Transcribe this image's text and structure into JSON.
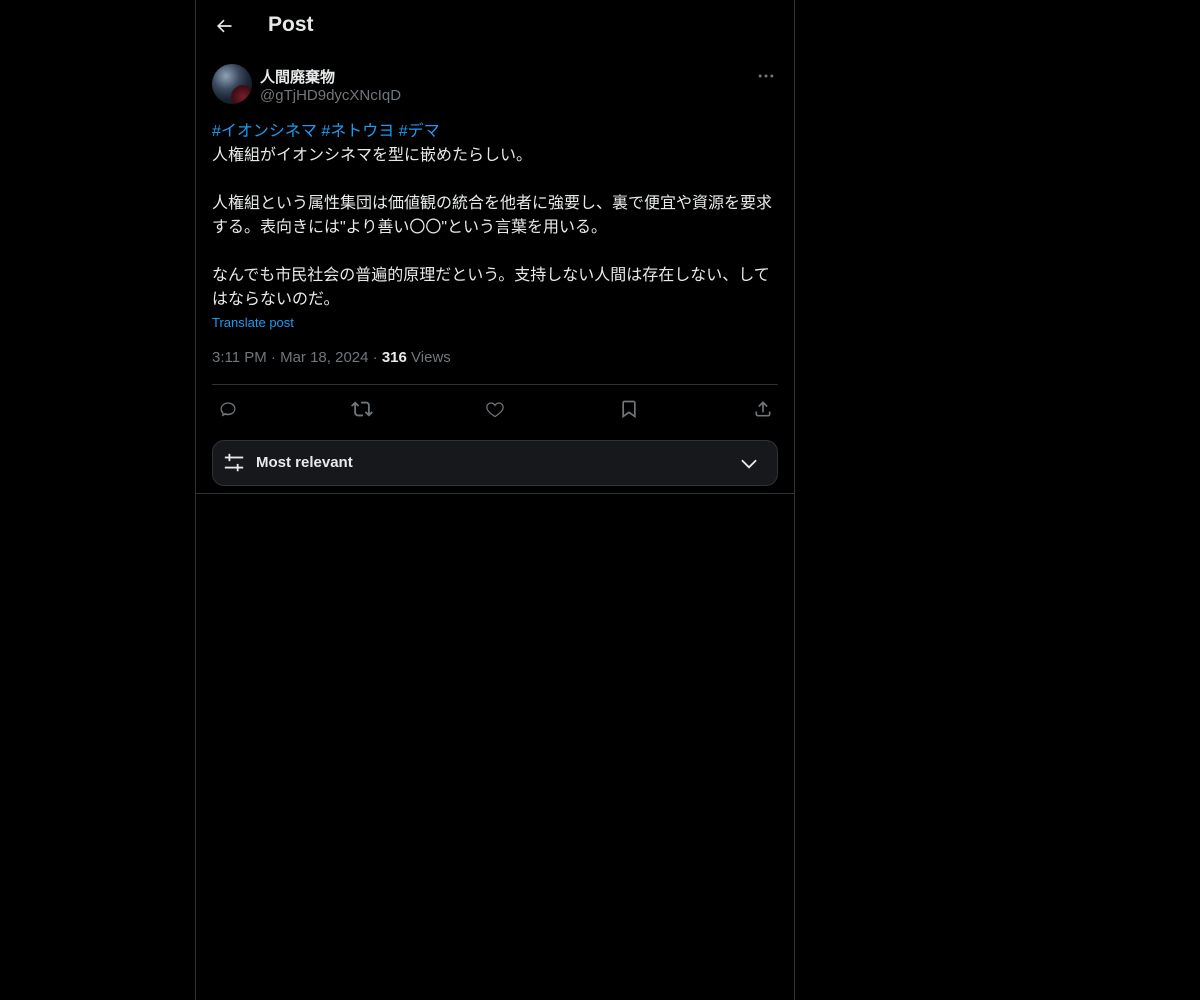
{
  "header": {
    "title": "Post",
    "back_icon": "arrow-left-icon"
  },
  "author": {
    "display_name": "人間廃棄物",
    "handle": "@gTjHD9dycXNcIqD",
    "more_icon": "more-horizontal-icon"
  },
  "post": {
    "hashtags": [
      "#イオンシネマ",
      "#ネトウヨ",
      "#デマ"
    ],
    "paragraphs": [
      "人権組がイオンシネマを型に嵌めたらしい。",
      "人権組という属性集団は価値観の統合を他者に強要し、裏で便宜や資源を要求する。表向きには\"より善い〇〇\"という言葉を用いる。",
      "なんでも市民社会の普遍的原理だという。支持しない人間は存在しない、してはならないのだ。"
    ],
    "translate_label": "Translate post",
    "time": "3:11 PM",
    "separator": "·",
    "date": "Mar 18, 2024",
    "views_count": "316",
    "views_label": "Views"
  },
  "actions": [
    {
      "icon": "reply-icon"
    },
    {
      "icon": "repost-icon"
    },
    {
      "icon": "like-icon"
    },
    {
      "icon": "bookmark-icon"
    },
    {
      "icon": "share-icon"
    }
  ],
  "sort": {
    "label": "Most relevant",
    "icon": "sliders-icon",
    "chevron_icon": "chevron-down-icon"
  },
  "colors": {
    "background": "#000000",
    "text": "#e7e9ea",
    "muted": "#71767b",
    "accent": "#1d9bf0",
    "border": "#2f3336"
  }
}
